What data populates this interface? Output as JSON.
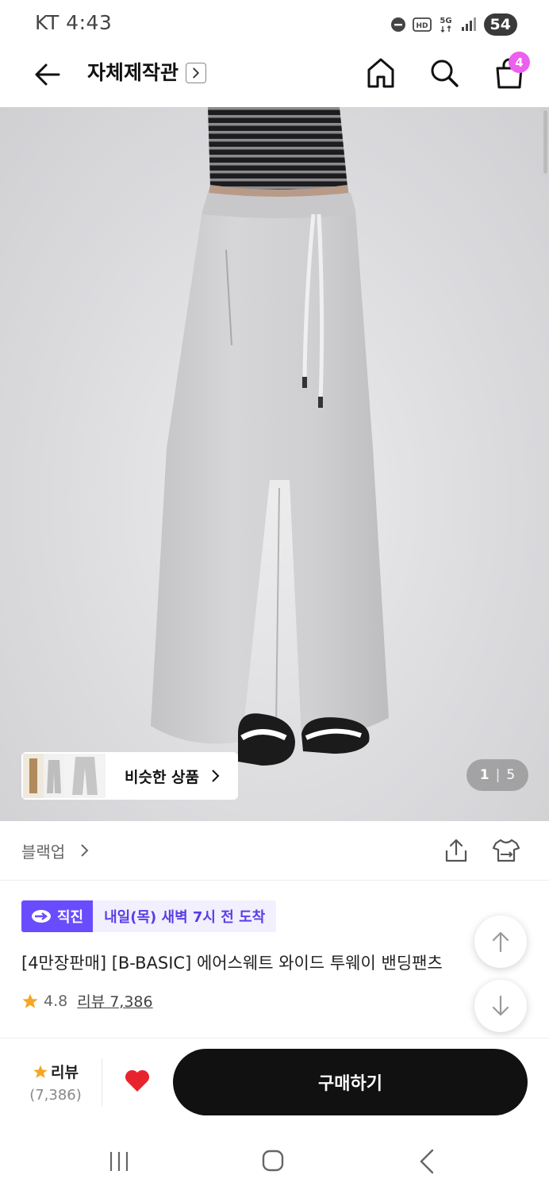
{
  "status_bar": {
    "carrier_time": "KT 4:43",
    "battery": "54"
  },
  "header": {
    "title": "자체제작관",
    "cart_count": "4"
  },
  "gallery": {
    "similar_label": "비슷한 상품",
    "page_current": "1",
    "page_total": "5"
  },
  "brand": {
    "name": "블랙업"
  },
  "delivery": {
    "badge": "직진",
    "arrival": "내일(목) 새벽 7시 전 도착"
  },
  "product": {
    "title": "[4만장판매] [B-BASIC] 에어스웨트 와이드 투웨이 밴딩팬츠",
    "rating": "4.8",
    "review_link": "리뷰 7,386"
  },
  "bottom_bar": {
    "review_label": "리뷰",
    "review_count": "(7,386)",
    "buy_label": "구매하기"
  },
  "colors": {
    "accent_purple": "#6a4cff",
    "badge_pink": "#ec5ff0",
    "heart_red": "#e8232e",
    "star": "#f5a623"
  }
}
